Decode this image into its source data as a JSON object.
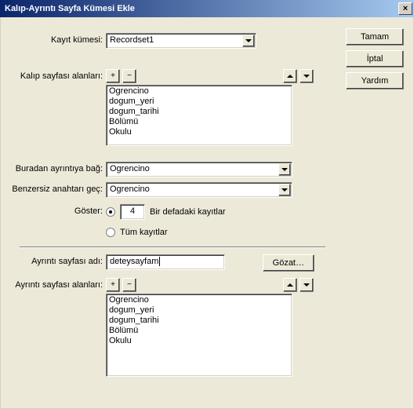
{
  "window": {
    "title": "Kalıp-Ayrıntı Sayfa Kümesi Ekle"
  },
  "buttons": {
    "ok": "Tamam",
    "cancel": "İptal",
    "help": "Yardım",
    "browse": "Gözat…"
  },
  "labels": {
    "recordset": "Kayıt kümesi:",
    "master_fields": "Kalıp sayfası alanları:",
    "link_from": "Buradan ayrıntıya bağ:",
    "unique_key": "Benzersiz anahtarı geç:",
    "show": "Göster:",
    "records_at_once": "Bir defadaki kayıtlar",
    "all_records": "Tüm kayıtlar",
    "detail_page": "Ayrıntı sayfası adı:",
    "detail_fields": "Ayrıntı sayfası alanları:"
  },
  "icons": {
    "plus": "+",
    "minus": "−"
  },
  "values": {
    "recordset": "Recordset1",
    "link_from": "Ogrencino",
    "unique_key": "Ogrencino",
    "per_page": "4",
    "detail_page": "deteysayfam"
  },
  "master_list": [
    "Ogrencino",
    "dogum_yeri",
    "dogum_tarihi",
    "Bölümü",
    "Okulu"
  ],
  "detail_list": [
    "Ogrencino",
    "dogum_yeri",
    "dogum_tarihi",
    "Bölümü",
    "Okulu"
  ]
}
